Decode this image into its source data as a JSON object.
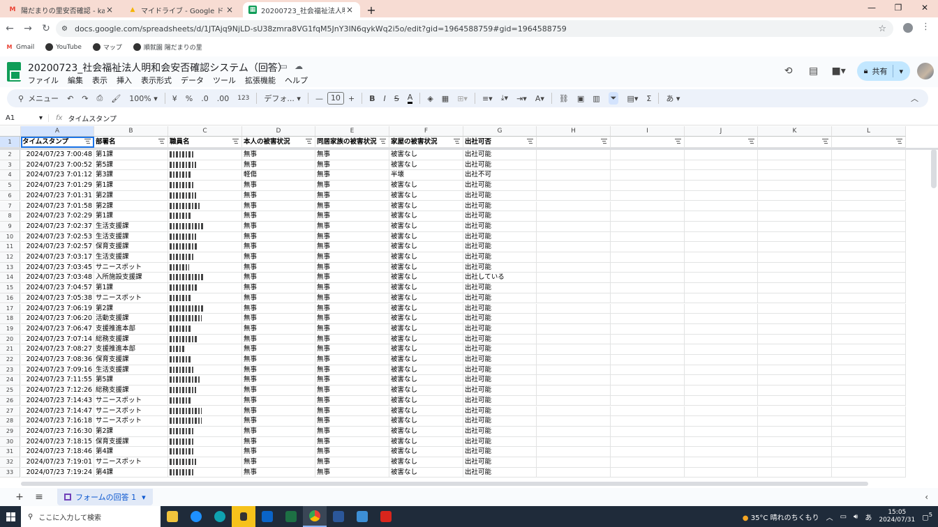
{
  "browser": {
    "tabs": [
      {
        "title": "陽だまりの里安否確認 - kanri.hid",
        "icon": "gmail-icon"
      },
      {
        "title": "マイドライブ - Google ドライブ",
        "icon": "drive-icon"
      },
      {
        "title": "20200723_社会福祉法人明和会",
        "icon": "sheets-icon"
      }
    ],
    "url": "docs.google.com/spreadsheets/d/1JTAjq9NjLD-sU38zmra8VG1fqM5JnY3IN6qykWq2i5o/edit?gid=1964588759#gid=1964588759",
    "bookmarks": [
      "Gmail",
      "YouTube",
      "マップ",
      "順就園 陽だまりの里"
    ]
  },
  "sheet": {
    "title": "20200723_社会福祉法人明和会安否確認システム（回答）",
    "menus": [
      "ファイル",
      "編集",
      "表示",
      "挿入",
      "表示形式",
      "データ",
      "ツール",
      "拡張機能",
      "ヘルプ"
    ],
    "share_label": "共有",
    "toolbar": {
      "menu_label": "メニュー",
      "zoom": "100%",
      "currency": "¥",
      "percent": "%",
      "dec_minus": ".0",
      "dec_plus": ".00",
      "numfmt": "123",
      "font": "デフォ...",
      "font_size": "10",
      "ime": "あ"
    },
    "name_box": "A1",
    "formula": "タイムスタンプ",
    "columns": [
      "A",
      "B",
      "C",
      "D",
      "E",
      "F",
      "G",
      "H",
      "I",
      "J",
      "K",
      "L"
    ],
    "headers": [
      "タイムスタンプ",
      "部署名",
      "職員名",
      "本人の被害状況",
      "同居家族の被害状況",
      "家屋の被害状況",
      "出社可否"
    ],
    "rows": [
      [
        "2024/07/23 7:00:48",
        "第1課",
        "",
        "無事",
        "無事",
        "被害なし",
        "出社可能"
      ],
      [
        "2024/07/23 7:00:52",
        "第5課",
        "",
        "無事",
        "無事",
        "被害なし",
        "出社可能"
      ],
      [
        "2024/07/23 7:01:12",
        "第3課",
        "",
        "軽傷",
        "無事",
        "半壊",
        "出社不可"
      ],
      [
        "2024/07/23 7:01:29",
        "第1課",
        "",
        "無事",
        "無事",
        "被害なし",
        "出社可能"
      ],
      [
        "2024/07/23 7:01:31",
        "第2課",
        "",
        "無事",
        "無事",
        "被害なし",
        "出社可能"
      ],
      [
        "2024/07/23 7:01:58",
        "第2課",
        "",
        "無事",
        "無事",
        "被害なし",
        "出社可能"
      ],
      [
        "2024/07/23 7:02:29",
        "第1課",
        "",
        "無事",
        "無事",
        "被害なし",
        "出社可能"
      ],
      [
        "2024/07/23 7:02:37",
        "生活支援課",
        "",
        "無事",
        "無事",
        "被害なし",
        "出社可能"
      ],
      [
        "2024/07/23 7:02:53",
        "生活支援課",
        "",
        "無事",
        "無事",
        "被害なし",
        "出社可能"
      ],
      [
        "2024/07/23 7:02:57",
        "保育支援課",
        "",
        "無事",
        "無事",
        "被害なし",
        "出社可能"
      ],
      [
        "2024/07/23 7:03:17",
        "生活支援課",
        "",
        "無事",
        "無事",
        "被害なし",
        "出社可能"
      ],
      [
        "2024/07/23 7:03:45",
        "サニースポット",
        "",
        "無事",
        "無事",
        "被害なし",
        "出社可能"
      ],
      [
        "2024/07/23 7:03:48",
        "入所施設支援課",
        "",
        "無事",
        "無事",
        "被害なし",
        "出社している"
      ],
      [
        "2024/07/23 7:04:57",
        "第1課",
        "",
        "無事",
        "無事",
        "被害なし",
        "出社可能"
      ],
      [
        "2024/07/23 7:05:38",
        "サニースポット",
        "",
        "無事",
        "無事",
        "被害なし",
        "出社可能"
      ],
      [
        "2024/07/23 7:06:19",
        "第2課",
        "",
        "無事",
        "無事",
        "被害なし",
        "出社可能"
      ],
      [
        "2024/07/23 7:06:20",
        "活動支援課",
        "",
        "無事",
        "無事",
        "被害なし",
        "出社可能"
      ],
      [
        "2024/07/23 7:06:47",
        "支援推進本部",
        "",
        "無事",
        "無事",
        "被害なし",
        "出社可能"
      ],
      [
        "2024/07/23 7:07:14",
        "総務支援課",
        "",
        "無事",
        "無事",
        "被害なし",
        "出社可能"
      ],
      [
        "2024/07/23 7:08:27",
        "支援推進本部",
        "",
        "無事",
        "無事",
        "被害なし",
        "出社可能"
      ],
      [
        "2024/07/23 7:08:36",
        "保育支援課",
        "",
        "無事",
        "無事",
        "被害なし",
        "出社可能"
      ],
      [
        "2024/07/23 7:09:16",
        "生活支援課",
        "",
        "無事",
        "無事",
        "被害なし",
        "出社可能"
      ],
      [
        "2024/07/23 7:11:55",
        "第5課",
        "",
        "無事",
        "無事",
        "被害なし",
        "出社可能"
      ],
      [
        "2024/07/23 7:12:26",
        "総務支援課",
        "",
        "無事",
        "無事",
        "被害なし",
        "出社可能"
      ],
      [
        "2024/07/23 7:14:43",
        "サニースポット",
        "",
        "無事",
        "無事",
        "被害なし",
        "出社可能"
      ],
      [
        "2024/07/23 7:14:47",
        "サニースポット",
        "",
        "無事",
        "無事",
        "被害なし",
        "出社可能"
      ],
      [
        "2024/07/23 7:16:18",
        "サニースポット",
        "",
        "無事",
        "無事",
        "被害なし",
        "出社可能"
      ],
      [
        "2024/07/23 7:16:30",
        "第2課",
        "",
        "無事",
        "無事",
        "被害なし",
        "出社可能"
      ],
      [
        "2024/07/23 7:18:15",
        "保育支援課",
        "",
        "無事",
        "無事",
        "被害なし",
        "出社可能"
      ],
      [
        "2024/07/23 7:18:46",
        "第4課",
        "",
        "無事",
        "無事",
        "被害なし",
        "出社可能"
      ],
      [
        "2024/07/23 7:19:01",
        "サニースポット",
        "",
        "無事",
        "無事",
        "被害なし",
        "出社可能"
      ],
      [
        "2024/07/23 7:19:24",
        "第4課",
        "",
        "無事",
        "無事",
        "被害なし",
        "出社可能"
      ]
    ],
    "sheet_tab": "フォームの回答 1"
  },
  "taskbar": {
    "search_placeholder": "ここに入力して検索",
    "weather": "35°C 晴れのちくもり",
    "ime": "あ",
    "time": "15:05",
    "date": "2024/07/31",
    "notif_count": "5"
  },
  "colors": {
    "tabbar": "#f7dcd3",
    "sheets_green": "#0f9d58",
    "selection": "#1a73e8",
    "share_bg": "#c2e7ff"
  }
}
